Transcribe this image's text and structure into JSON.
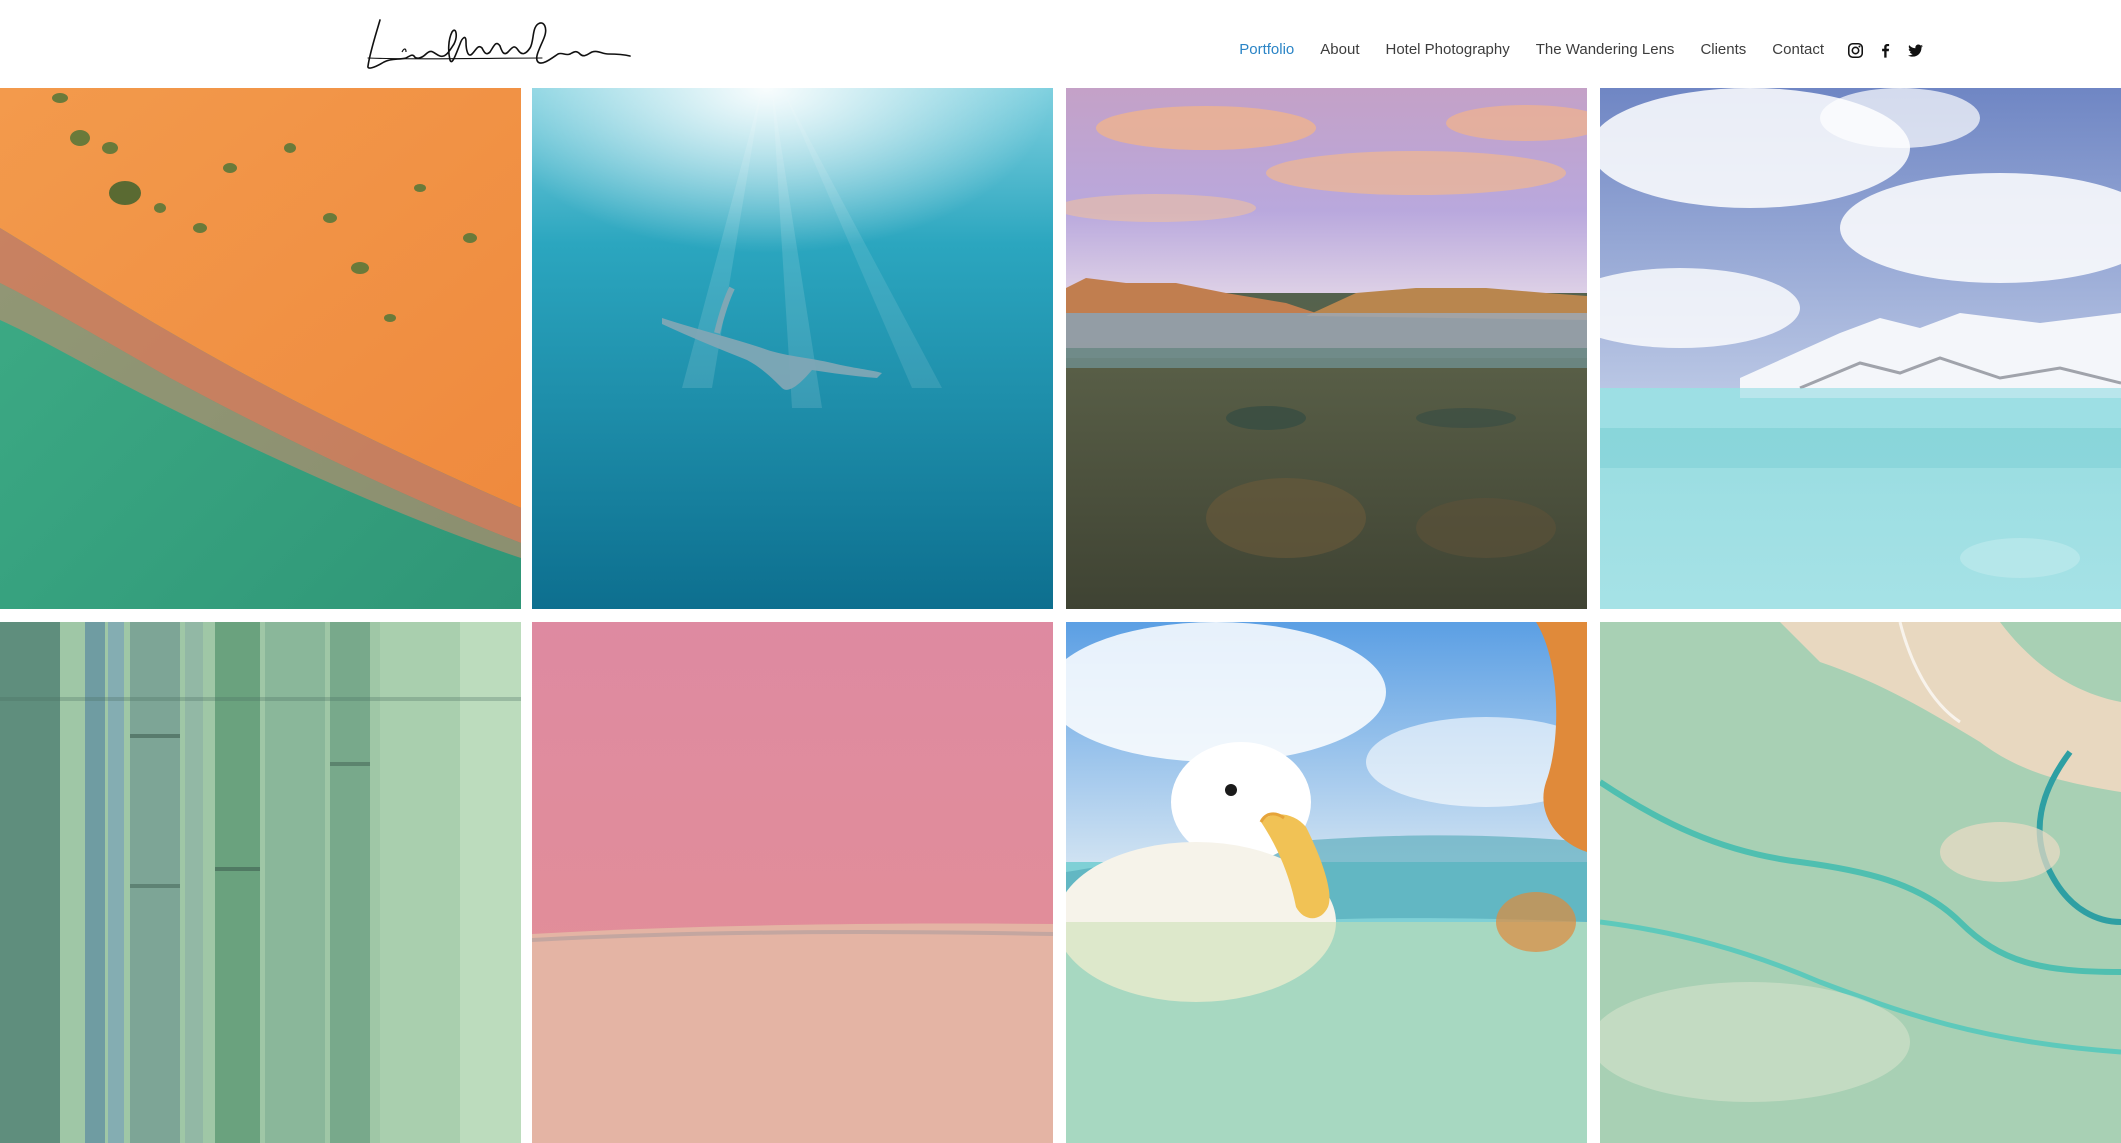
{
  "site": {
    "logo_text": "Lisa Michele Burns"
  },
  "nav": {
    "items": [
      {
        "label": "Portfolio",
        "active": true
      },
      {
        "label": "About",
        "active": false
      },
      {
        "label": "Hotel Photography",
        "active": false
      },
      {
        "label": "The Wandering Lens",
        "active": false
      },
      {
        "label": "Clients",
        "active": false
      },
      {
        "label": "Contact",
        "active": false
      }
    ],
    "active_color": "#2a84c6",
    "text_color": "#3d3d3d"
  },
  "social": [
    {
      "icon": "instagram-icon"
    },
    {
      "icon": "facebook-icon"
    },
    {
      "icon": "twitter-icon"
    }
  ],
  "gallery": {
    "photos": [
      {
        "subject": "aerial-orange-sand-green-water"
      },
      {
        "subject": "underwater-swimmer-sunrays"
      },
      {
        "subject": "mountains-lake-split-view"
      },
      {
        "subject": "snowy-mountain-turquoise-water"
      },
      {
        "subject": "bamboo-forest"
      },
      {
        "subject": "pink-lake"
      },
      {
        "subject": "white-duck-split-view"
      },
      {
        "subject": "aerial-tidal-sandbanks"
      }
    ]
  }
}
